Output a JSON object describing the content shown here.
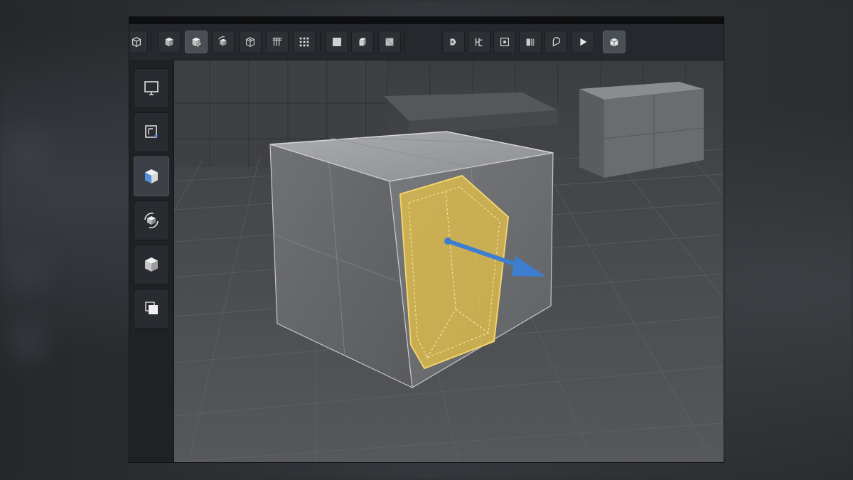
{
  "window": {
    "title": ""
  },
  "toolbar": {
    "left_tools": [
      {
        "icon": "cube-outline-icon"
      },
      {
        "icon": "cube-solid-icon"
      },
      {
        "icon": "cube-select-icon",
        "active": true
      },
      {
        "icon": "cube-rotate-icon"
      },
      {
        "icon": "cube-wire-icon"
      },
      {
        "icon": "pillars-icon"
      },
      {
        "icon": "grid-dots-icon"
      }
    ],
    "mid_tools": [
      {
        "icon": "face-view-icon"
      },
      {
        "icon": "box-view-icon"
      },
      {
        "icon": "panel-view-icon"
      }
    ],
    "right_tools": [
      {
        "icon": "extrude-icon"
      },
      {
        "icon": "split-icon"
      },
      {
        "icon": "snap-icon"
      },
      {
        "icon": "bevel-icon"
      },
      {
        "icon": "knife-icon"
      },
      {
        "icon": "play-icon"
      },
      {
        "icon": "render-icon",
        "active": true
      }
    ]
  },
  "sidebar": {
    "tools": [
      {
        "icon": "monitor-icon"
      },
      {
        "icon": "select-region-icon"
      },
      {
        "icon": "cube-blue-icon",
        "active": true
      },
      {
        "icon": "rotate-object-icon"
      },
      {
        "icon": "solid-cube-icon"
      },
      {
        "icon": "duplicate-icon"
      }
    ]
  },
  "viewport": {
    "selection_color": "#e8c34a",
    "gizmo_color": "#3c7fd1",
    "floor_color": "#4a4c4f"
  }
}
